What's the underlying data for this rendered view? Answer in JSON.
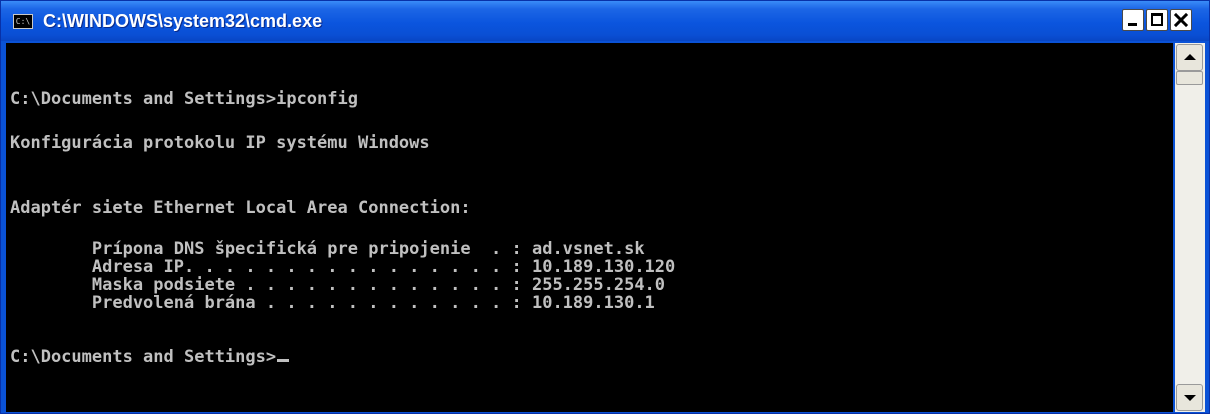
{
  "window": {
    "title": "C:\\WINDOWS\\system32\\cmd.exe",
    "icon_text": "C:\\"
  },
  "console": {
    "lines": [
      "C:\\Documents and Settings>ipconfig",
      "Konfigurácia protokolu IP systému Windows",
      "Adaptér siete Ethernet Local Area Connection:",
      "        Prípona DNS špecifická pre pripojenie  . : ad.vsnet.sk",
      "        Adresa IP. . . . . . . . . . . . . . . . : 10.189.130.120",
      "        Maska podsiete . . . . . . . . . . . . . : 255.255.254.0",
      "        Predvolená brána . . . . . . . . . . . . : 10.189.130.1",
      "C:\\Documents and Settings>"
    ]
  }
}
